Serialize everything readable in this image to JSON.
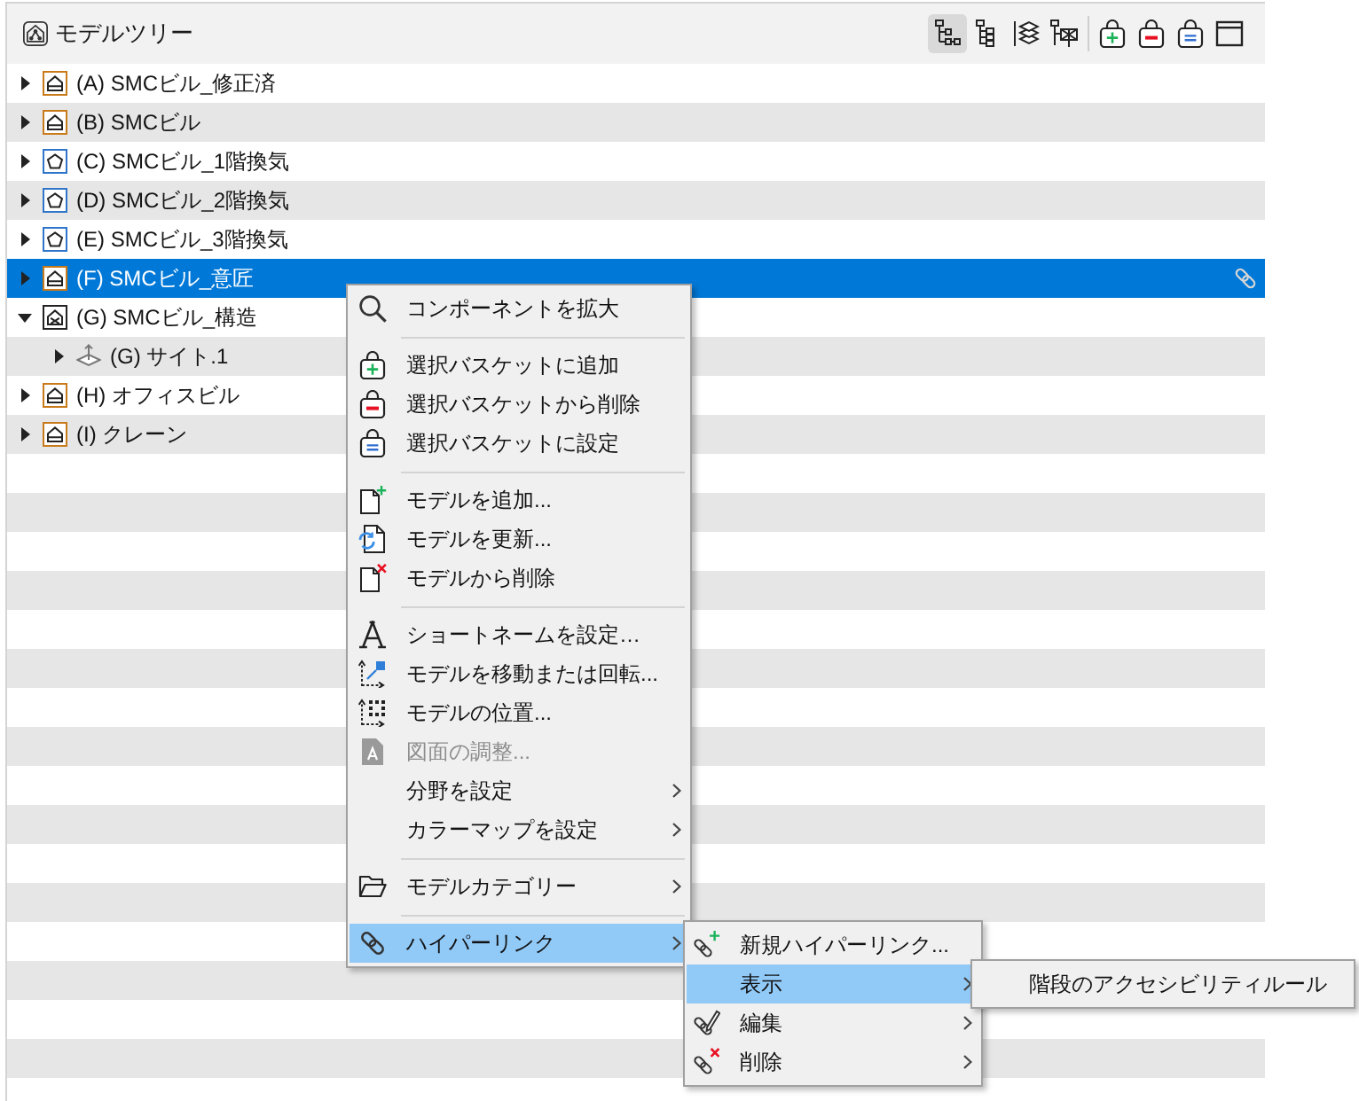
{
  "panel": {
    "title": "モデルツリー",
    "toolbar": [
      [
        {
          "selected": true
        },
        {
          "selected": false
        },
        {
          "selected": false
        },
        {
          "selected": false
        }
      ],
      [
        {
          "selected": false
        },
        {
          "selected": false
        },
        {
          "selected": false
        },
        {
          "selected": false
        }
      ]
    ]
  },
  "tree": {
    "items": [
      {
        "label": "(A) SMCビル_修正済",
        "kind": "building",
        "expanded": false,
        "selected": false,
        "linked": false
      },
      {
        "label": "(B) SMCビル",
        "kind": "building",
        "expanded": false,
        "selected": false,
        "linked": false
      },
      {
        "label": "(C) SMCビル_1階換気",
        "kind": "ventilation",
        "expanded": false,
        "selected": false,
        "linked": false
      },
      {
        "label": "(D) SMCビル_2階換気",
        "kind": "ventilation",
        "expanded": false,
        "selected": false,
        "linked": false
      },
      {
        "label": "(E) SMCビル_3階換気",
        "kind": "ventilation",
        "expanded": false,
        "selected": false,
        "linked": false
      },
      {
        "label": "(F) SMCビル_意匠",
        "kind": "building",
        "expanded": false,
        "selected": true,
        "linked": true
      },
      {
        "label": "(G) SMCビル_構造",
        "kind": "structure",
        "expanded": true,
        "selected": false,
        "linked": false,
        "children": [
          {
            "label": "(G) サイト.1",
            "kind": "site",
            "expanded": false,
            "selected": false,
            "linked": false
          }
        ]
      },
      {
        "label": "(H) オフィスビル",
        "kind": "building",
        "expanded": false,
        "selected": false,
        "linked": false
      },
      {
        "label": "(I) クレーン",
        "kind": "building",
        "expanded": false,
        "selected": false,
        "linked": false
      }
    ]
  },
  "context_menu": {
    "groups": [
      [
        {
          "label": "コンポーネントを拡大",
          "selected": false,
          "disabled": false,
          "has_submenu": false
        }
      ],
      [
        {
          "label": "選択バスケットに追加",
          "selected": false,
          "disabled": false,
          "has_submenu": false
        },
        {
          "label": "選択バスケットから削除",
          "selected": false,
          "disabled": false,
          "has_submenu": false
        },
        {
          "label": "選択バスケットに設定",
          "selected": false,
          "disabled": false,
          "has_submenu": false
        }
      ],
      [
        {
          "label": "モデルを追加...",
          "selected": false,
          "disabled": false,
          "has_submenu": false
        },
        {
          "label": "モデルを更新...",
          "selected": false,
          "disabled": false,
          "has_submenu": false
        },
        {
          "label": "モデルから削除",
          "selected": false,
          "disabled": false,
          "has_submenu": false
        }
      ],
      [
        {
          "label": "ショートネームを設定…",
          "selected": false,
          "disabled": false,
          "has_submenu": false
        },
        {
          "label": "モデルを移動または回転...",
          "selected": false,
          "disabled": false,
          "has_submenu": false
        },
        {
          "label": "モデルの位置...",
          "selected": false,
          "disabled": false,
          "has_submenu": false
        },
        {
          "label": "図面の調整...",
          "selected": false,
          "disabled": true,
          "has_submenu": false
        },
        {
          "label": "分野を設定",
          "selected": false,
          "disabled": false,
          "has_submenu": true
        },
        {
          "label": "カラーマップを設定",
          "selected": false,
          "disabled": false,
          "has_submenu": true
        }
      ],
      [
        {
          "label": "モデルカテゴリー",
          "selected": false,
          "disabled": false,
          "has_submenu": true
        }
      ],
      [
        {
          "label": "ハイパーリンク",
          "selected": true,
          "disabled": false,
          "has_submenu": true
        }
      ]
    ]
  },
  "submenu": {
    "items": [
      {
        "label": "新規ハイパーリンク...",
        "selected": false,
        "has_submenu": false
      },
      {
        "label": "表示",
        "selected": true,
        "has_submenu": true
      },
      {
        "label": "編集",
        "selected": false,
        "has_submenu": true
      },
      {
        "label": "削除",
        "selected": false,
        "has_submenu": true
      }
    ]
  },
  "submenu_2": {
    "items": [
      {
        "label": "階段のアクセシビリティルール",
        "selected": false
      }
    ]
  }
}
